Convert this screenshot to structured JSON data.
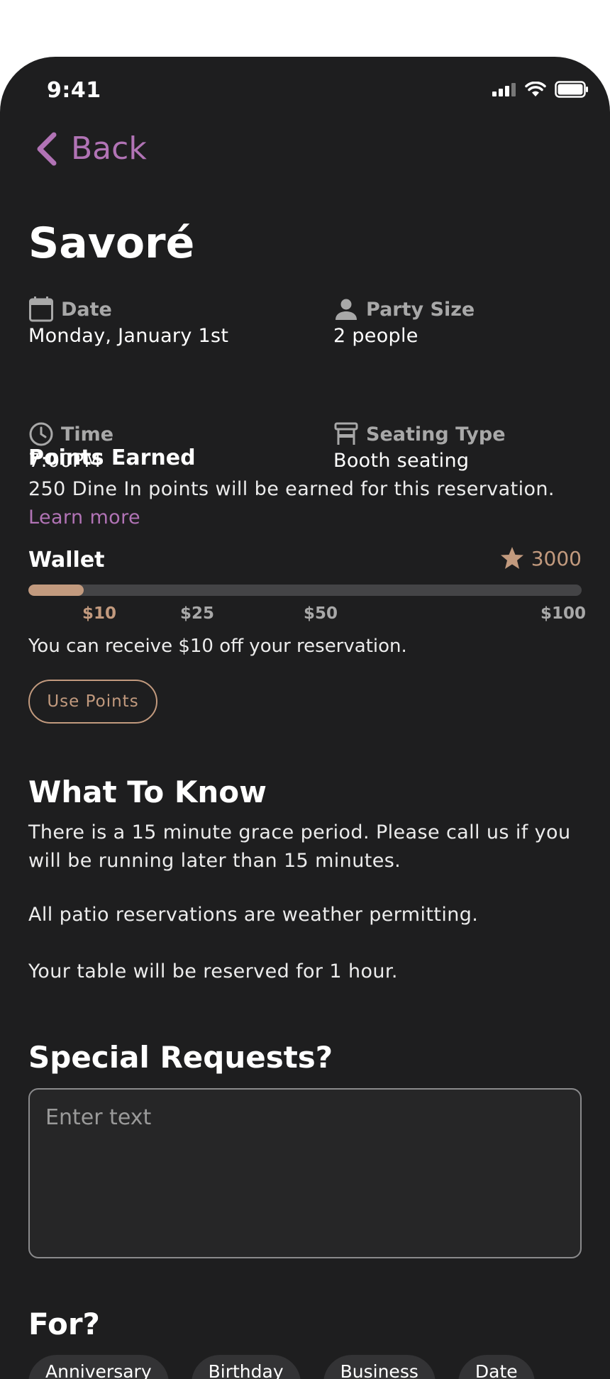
{
  "status_bar": {
    "time": "9:41"
  },
  "nav": {
    "back_label": "Back"
  },
  "restaurant": {
    "name": "Savoré"
  },
  "details": {
    "date": {
      "label": "Date",
      "value": "Monday, January 1st",
      "icon": "calendar-icon"
    },
    "party_size": {
      "label": "Party Size",
      "value": "2 people",
      "icon": "person-icon"
    },
    "time": {
      "label": "Time",
      "value": "7:00PM",
      "icon": "clock-icon"
    },
    "seating_type": {
      "label": "Seating Type",
      "value": "Booth seating",
      "icon": "seat-icon"
    }
  },
  "points": {
    "title": "Points Earned",
    "description": "250 Dine In points will be earned for this reservation.",
    "learn_more": "Learn more"
  },
  "wallet": {
    "title": "Wallet",
    "balance": "3000",
    "progress_fraction": 0.1,
    "ticks": [
      "$10",
      "$25",
      "$50",
      "$100"
    ],
    "message": "You can receive $10 off your reservation.",
    "use_points_label": "Use Points",
    "accent_color": "#c29a7e",
    "track_color": "#444446"
  },
  "what_to_know": {
    "title": "What To Know",
    "items": [
      "There is a 15 minute grace period. Please call us if you will be running later than 15 minutes.",
      "All patio reservations are weather permitting.",
      "Your table will be reserved for 1 hour."
    ]
  },
  "special_requests": {
    "title": "Special Requests?",
    "placeholder": "Enter text"
  },
  "occasion": {
    "title": "For?",
    "chips": [
      "Anniversary",
      "Birthday",
      "Business",
      "Date"
    ]
  },
  "colors": {
    "background": "#1e1e1f",
    "link": "#b173b5",
    "accent": "#c29a7e"
  }
}
